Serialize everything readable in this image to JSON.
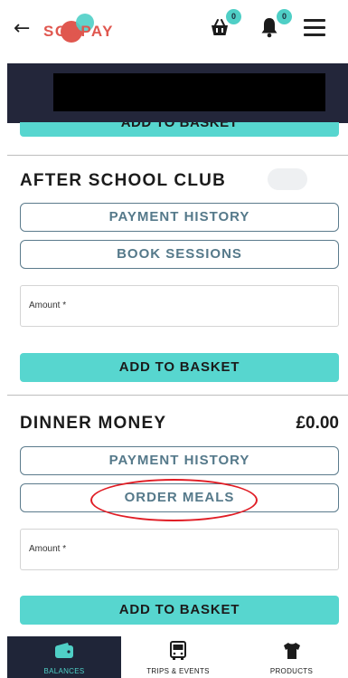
{
  "header": {
    "logo_text": "SCOPAY",
    "basket_count": "0",
    "notification_count": "0"
  },
  "top_section": {
    "add_to_basket_label": "ADD TO BASKET"
  },
  "after_school_club": {
    "title": "AFTER SCHOOL CLUB",
    "payment_history_label": "PAYMENT HISTORY",
    "book_sessions_label": "BOOK SESSIONS",
    "amount_placeholder": "Amount *",
    "add_to_basket_label": "ADD TO BASKET"
  },
  "dinner_money": {
    "title": "DINNER MONEY",
    "balance": "£0.00",
    "payment_history_label": "PAYMENT HISTORY",
    "order_meals_label": "ORDER MEALS",
    "amount_placeholder": "Amount *",
    "add_to_basket_label": "ADD TO BASKET"
  },
  "bottom_nav": {
    "items": [
      {
        "label": "BALANCES",
        "icon": "wallet-icon",
        "active": true
      },
      {
        "label": "TRIPS & EVENTS",
        "icon": "bus-icon",
        "active": false
      },
      {
        "label": "PRODUCTS",
        "icon": "tshirt-icon",
        "active": false
      }
    ]
  },
  "colors": {
    "accent_teal": "#57d6cf",
    "brand_red": "#e0574f",
    "nav_dark": "#1f2538",
    "annotation_red": "#e01c24"
  }
}
